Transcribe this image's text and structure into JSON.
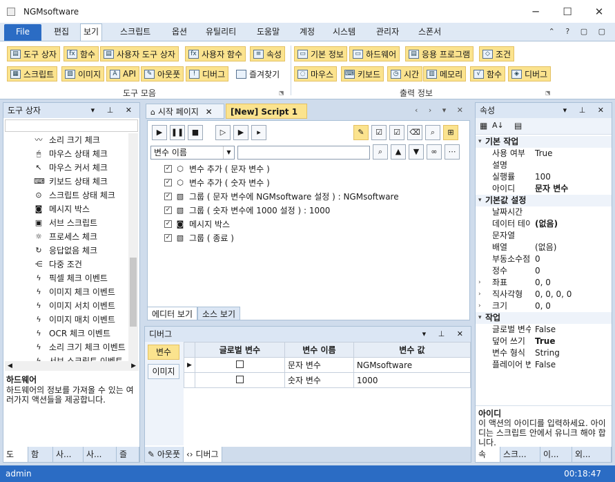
{
  "app": {
    "title": "NGMsoftware"
  },
  "window": {
    "minimize": "─",
    "maximize": "☐",
    "close": "✕"
  },
  "menu": {
    "file": "File",
    "items": [
      "편집",
      "보기",
      "스크립트",
      "옵션",
      "유틸리티",
      "도움말",
      "계정",
      "시스템",
      "관리자",
      "스폰서"
    ],
    "active": "보기"
  },
  "ribbon": {
    "group1": {
      "label": "도구 모음",
      "row1": [
        "도구 상자",
        "함수",
        "사용자 도구 상자",
        "사용자 함수",
        "속성"
      ],
      "row2": [
        "스크립트",
        "이미지",
        "API",
        "아웃풋",
        "디버그",
        "즐겨찾기"
      ]
    },
    "group2": {
      "label": "출력 정보",
      "row1": [
        "기본 정보",
        "하드웨어",
        "응용 프로그램",
        "조건"
      ],
      "row2": [
        "마우스",
        "키보드",
        "시간",
        "메모리",
        "함수",
        "디버그"
      ]
    }
  },
  "toolbox": {
    "header": "도구 상자",
    "items": [
      {
        "icon": "waveform-icon",
        "glyph": "〰",
        "label": "소리 크기 체크"
      },
      {
        "icon": "mouse-icon",
        "glyph": "🖱",
        "label": "마우스 상태 체크"
      },
      {
        "icon": "cursor-icon",
        "glyph": "↖",
        "label": "마우스 커서 체크"
      },
      {
        "icon": "keyboard-icon",
        "glyph": "⌨",
        "label": "키보드 상태 체크"
      },
      {
        "icon": "script-icon",
        "glyph": "⊙",
        "label": "스크립트 상태 체크"
      },
      {
        "icon": "message-icon",
        "glyph": "◙",
        "label": "메시지 박스"
      },
      {
        "icon": "subscript-icon",
        "glyph": "▣",
        "label": "서브 스크립트"
      },
      {
        "icon": "process-icon",
        "glyph": "☼",
        "label": "프로세스 체크"
      },
      {
        "icon": "refresh-icon",
        "glyph": "↻",
        "label": "응답없음 체크"
      },
      {
        "icon": "share-icon",
        "glyph": "⋲",
        "label": "다중 조건"
      },
      {
        "icon": "bolt-icon",
        "glyph": "ϟ",
        "label": "픽셀 체크 이벤트"
      },
      {
        "icon": "bolt-icon",
        "glyph": "ϟ",
        "label": "이미지 체크 이벤트"
      },
      {
        "icon": "bolt-icon",
        "glyph": "ϟ",
        "label": "이미지 서치 이벤트"
      },
      {
        "icon": "bolt-icon",
        "glyph": "ϟ",
        "label": "이미지 매치 이벤트"
      },
      {
        "icon": "bolt-icon",
        "glyph": "ϟ",
        "label": "OCR 체크 이벤트"
      },
      {
        "icon": "bolt-icon",
        "glyph": "ϟ",
        "label": "소리 크기 체크 이벤트"
      },
      {
        "icon": "bolt-icon",
        "glyph": "ϟ",
        "label": "서브 스크립트 이벤트"
      }
    ],
    "desc_title": "하드웨어",
    "desc_text": "하드웨어의 정보를 가져올 수 있는 여러가지 액션들을 제공합니다.",
    "tabs": [
      "도",
      "함",
      "사...",
      "사...",
      "즐"
    ]
  },
  "editor": {
    "tabs": [
      "시작 페이지",
      "[New] Script 1"
    ],
    "dropdown": "변수 이름",
    "actions": [
      {
        "label": "변수 추가 ( 문자 변수 )",
        "glyph": "⬡"
      },
      {
        "label": "변수 추가 ( 숫자 변수 )",
        "glyph": "⬡"
      },
      {
        "label": "그룹 ( 문자 변수에 NGMsoftware 설정 ) : NGMsoftware",
        "glyph": "▧"
      },
      {
        "label": "그룹 ( 숫자 변수에 1000 설정 ) : 1000",
        "glyph": "▧"
      },
      {
        "label": "메시지 박스",
        "glyph": "◙"
      },
      {
        "label": "그룹 ( 종료 )",
        "glyph": "▧"
      }
    ],
    "view_tabs": [
      "에디터 보기",
      "소스 보기"
    ]
  },
  "debug": {
    "header": "디버그",
    "side_tabs": [
      "변수",
      "이미지"
    ],
    "columns": [
      "글로벌 변수",
      "변수 이름",
      "변수 값"
    ],
    "rows": [
      {
        "name": "문자 변수",
        "value": "NGMsoftware"
      },
      {
        "name": "숫자 변수",
        "value": "1000"
      }
    ],
    "bottom_tabs": [
      "아웃풋",
      "디버그"
    ]
  },
  "properties": {
    "header": "속성",
    "rows": [
      {
        "type": "cat",
        "key": "기본 작업"
      },
      {
        "key": "사용 여부",
        "value": "True"
      },
      {
        "key": "설명",
        "value": ""
      },
      {
        "key": "실행률",
        "value": "100"
      },
      {
        "key": "아이디",
        "value": "문자 변수",
        "bold": true
      },
      {
        "type": "cat",
        "key": "기본값 설정"
      },
      {
        "key": "날짜시간",
        "value": ""
      },
      {
        "key": "데이터 테이블",
        "value": "(없음)",
        "bold": true
      },
      {
        "key": "문자열",
        "value": ""
      },
      {
        "key": "배열",
        "value": "(없음)"
      },
      {
        "key": "부동소수점",
        "value": "0"
      },
      {
        "key": "정수",
        "value": "0"
      },
      {
        "key": "좌표",
        "value": "0, 0",
        "exp": true
      },
      {
        "key": "직사각형",
        "value": "0, 0, 0, 0",
        "exp": true
      },
      {
        "key": "크기",
        "value": "0, 0",
        "exp": true
      },
      {
        "type": "cat",
        "key": "작업"
      },
      {
        "key": "글로벌 변수",
        "value": "False"
      },
      {
        "key": "덮어 쓰기",
        "value": "True",
        "bold": true
      },
      {
        "key": "변수 형식",
        "value": "String"
      },
      {
        "key": "플레이어 변수",
        "value": "False"
      }
    ],
    "desc_title": "아이디",
    "desc_text": "이 액션의 아이디를 입력하세요. 아이디는 스크립트 안에서 유니크 해야 합니다.",
    "tabs": [
      "속",
      "스크...",
      "이...",
      "외..."
    ]
  },
  "status": {
    "user": "admin",
    "time": "00:18:47"
  }
}
